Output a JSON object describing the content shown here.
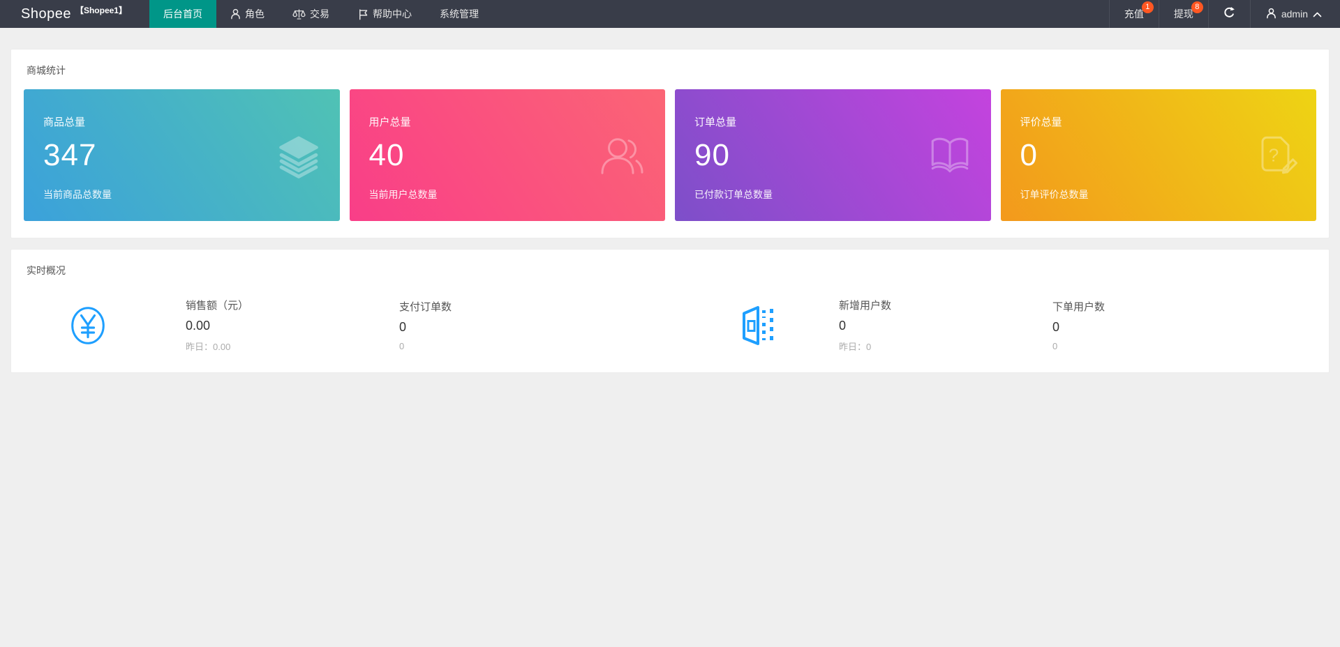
{
  "colors": {
    "navbar_bg": "#393D49",
    "accent_green": "#009688",
    "badge_orange": "#FF5722",
    "icon_blue": "#1E9FFF",
    "page_bg": "#EFEFEF"
  },
  "navbar": {
    "brand": "Shopee",
    "brand_sub": "【Shopee1】",
    "menu": [
      {
        "label": "后台首页",
        "icon": null,
        "active": true
      },
      {
        "label": "角色",
        "icon": "person",
        "active": false
      },
      {
        "label": "交易",
        "icon": "scales",
        "active": false
      },
      {
        "label": "帮助中心",
        "icon": "flag",
        "active": false
      },
      {
        "label": "系统管理",
        "icon": null,
        "active": false
      }
    ],
    "actions": [
      {
        "label": "充值",
        "badge": "1"
      },
      {
        "label": "提现",
        "badge": "8"
      }
    ],
    "refresh_icon": "refresh-icon",
    "user": "admin"
  },
  "stats_section": {
    "title": "商城统计",
    "cards": [
      {
        "label": "商品总量",
        "value": "347",
        "sub": "当前商品总数量",
        "icon": "layers-icon",
        "gradient": [
          "#3BA1DB",
          "#50C2B4"
        ]
      },
      {
        "label": "用户总量",
        "value": "40",
        "sub": "当前用户总数量",
        "icon": "users-icon",
        "gradient": [
          "#F93E88",
          "#FB6575"
        ]
      },
      {
        "label": "订单总量",
        "value": "90",
        "sub": "已付款订单总数量",
        "icon": "book-icon",
        "gradient": [
          "#7D4FC9",
          "#C443DE"
        ]
      },
      {
        "label": "评价总量",
        "value": "0",
        "sub": "订单评价总数量",
        "icon": "review-icon",
        "gradient": [
          "#F3991C",
          "#EED414"
        ]
      }
    ]
  },
  "realtime_section": {
    "title": "实时概况",
    "groups": [
      {
        "icon": "yuan-icon",
        "stats": [
          {
            "label": "销售额（元）",
            "value": "0.00",
            "sub": "昨日：0.00"
          },
          {
            "label": "支付订单数",
            "value": "0",
            "sub": "0"
          }
        ]
      },
      {
        "icon": "building-icon",
        "stats": [
          {
            "label": "新增用户数",
            "value": "0",
            "sub": "昨日：0"
          },
          {
            "label": "下单用户数",
            "value": "0",
            "sub": "0"
          }
        ]
      }
    ]
  }
}
